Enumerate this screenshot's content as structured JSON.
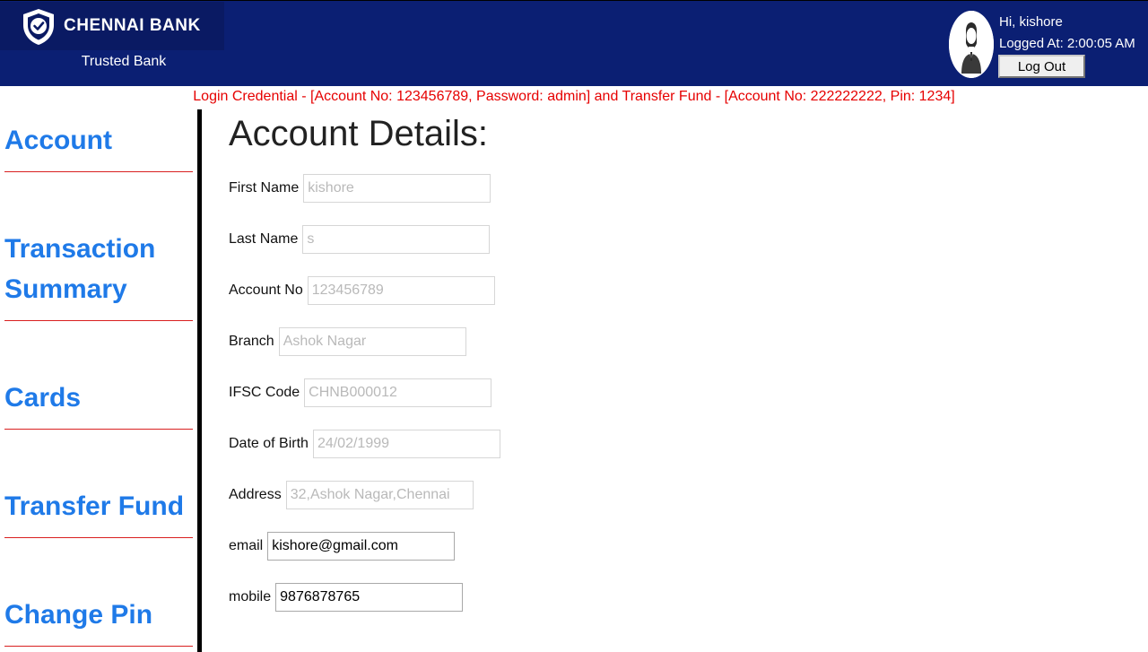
{
  "header": {
    "brand_name": "CHENNAI BANK",
    "tagline": "Trusted Bank",
    "greeting": "Hi, kishore",
    "login_time": "Logged At: 2:00:05 AM",
    "logout_label": "Log Out",
    "colors": {
      "header_bg": "#0b1f73",
      "brand_bg": "#0a1a63"
    },
    "icons": {
      "logo": "shield-check-icon",
      "avatar": "user-avatar"
    }
  },
  "banner": {
    "text": "Login Credential - [Account No: 123456789, Password: admin] and Transfer Fund - [Account No: 222222222, Pin: 1234]",
    "color": "#e60000"
  },
  "sidebar": {
    "items": [
      {
        "label": "Account"
      },
      {
        "label": "Transaction Summary"
      },
      {
        "label": "Cards"
      },
      {
        "label": "Transfer Fund"
      },
      {
        "label": "Change Pin"
      }
    ],
    "link_color": "#1f7ae8",
    "separator_color": "#d92020"
  },
  "main": {
    "title": "Account Details:",
    "fields": [
      {
        "label": "First Name",
        "placeholder": "kishore",
        "value": ""
      },
      {
        "label": "Last Name",
        "placeholder": "s",
        "value": ""
      },
      {
        "label": "Account No",
        "placeholder": "123456789",
        "value": ""
      },
      {
        "label": "Branch",
        "placeholder": "Ashok Nagar",
        "value": ""
      },
      {
        "label": "IFSC Code",
        "placeholder": "CHNB000012",
        "value": ""
      },
      {
        "label": "Date of Birth",
        "placeholder": "24/02/1999",
        "value": ""
      },
      {
        "label": "Address",
        "placeholder": "32,Ashok Nagar,Chennai",
        "value": ""
      },
      {
        "label": "email",
        "placeholder": "",
        "value": "kishore@gmail.com"
      },
      {
        "label": "mobile",
        "placeholder": "",
        "value": "9876878765"
      }
    ]
  }
}
